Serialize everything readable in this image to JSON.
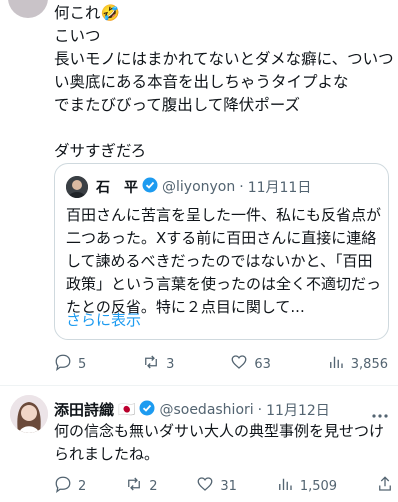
{
  "main_tweet": {
    "text": "何これ🤣\nこいつ\n長いモノにはまかれてないとダメな癖に、ついつい奥底にある本音を出しちゃうタイプよな\nでまたびびって腹出して降伏ポーズ\n\nダサすぎだろ",
    "quote": {
      "name": "石　平",
      "handle": "@liyonyon",
      "date": "11月11日",
      "text": "百田さんに苦言を呈した一件、私にも反省点が二つあった。Xする前に百田さんに直接に連絡して諫めるべきだったのではないかと、「百田政策」という言葉を使ったのは全く不適切だったとの反省。特に２点目に関して...",
      "more_label": "さらに表示"
    },
    "actions": {
      "replies": "5",
      "retweets": "3",
      "likes": "63",
      "views": "3,856"
    }
  },
  "reply_tweet": {
    "name": "添田詩織",
    "flag": "🇯🇵",
    "handle": "@soedashiori",
    "date": "11月12日",
    "text": "何の信念も無いダサい大人の典型事例を見せつけられましたね。",
    "actions": {
      "replies": "2",
      "retweets": "2",
      "likes": "31",
      "views": "1,509"
    }
  },
  "separator": "·",
  "colors": {
    "text": "#0f1419",
    "muted": "#536471",
    "link": "#1d9bf0",
    "border": "#cfd9de"
  }
}
